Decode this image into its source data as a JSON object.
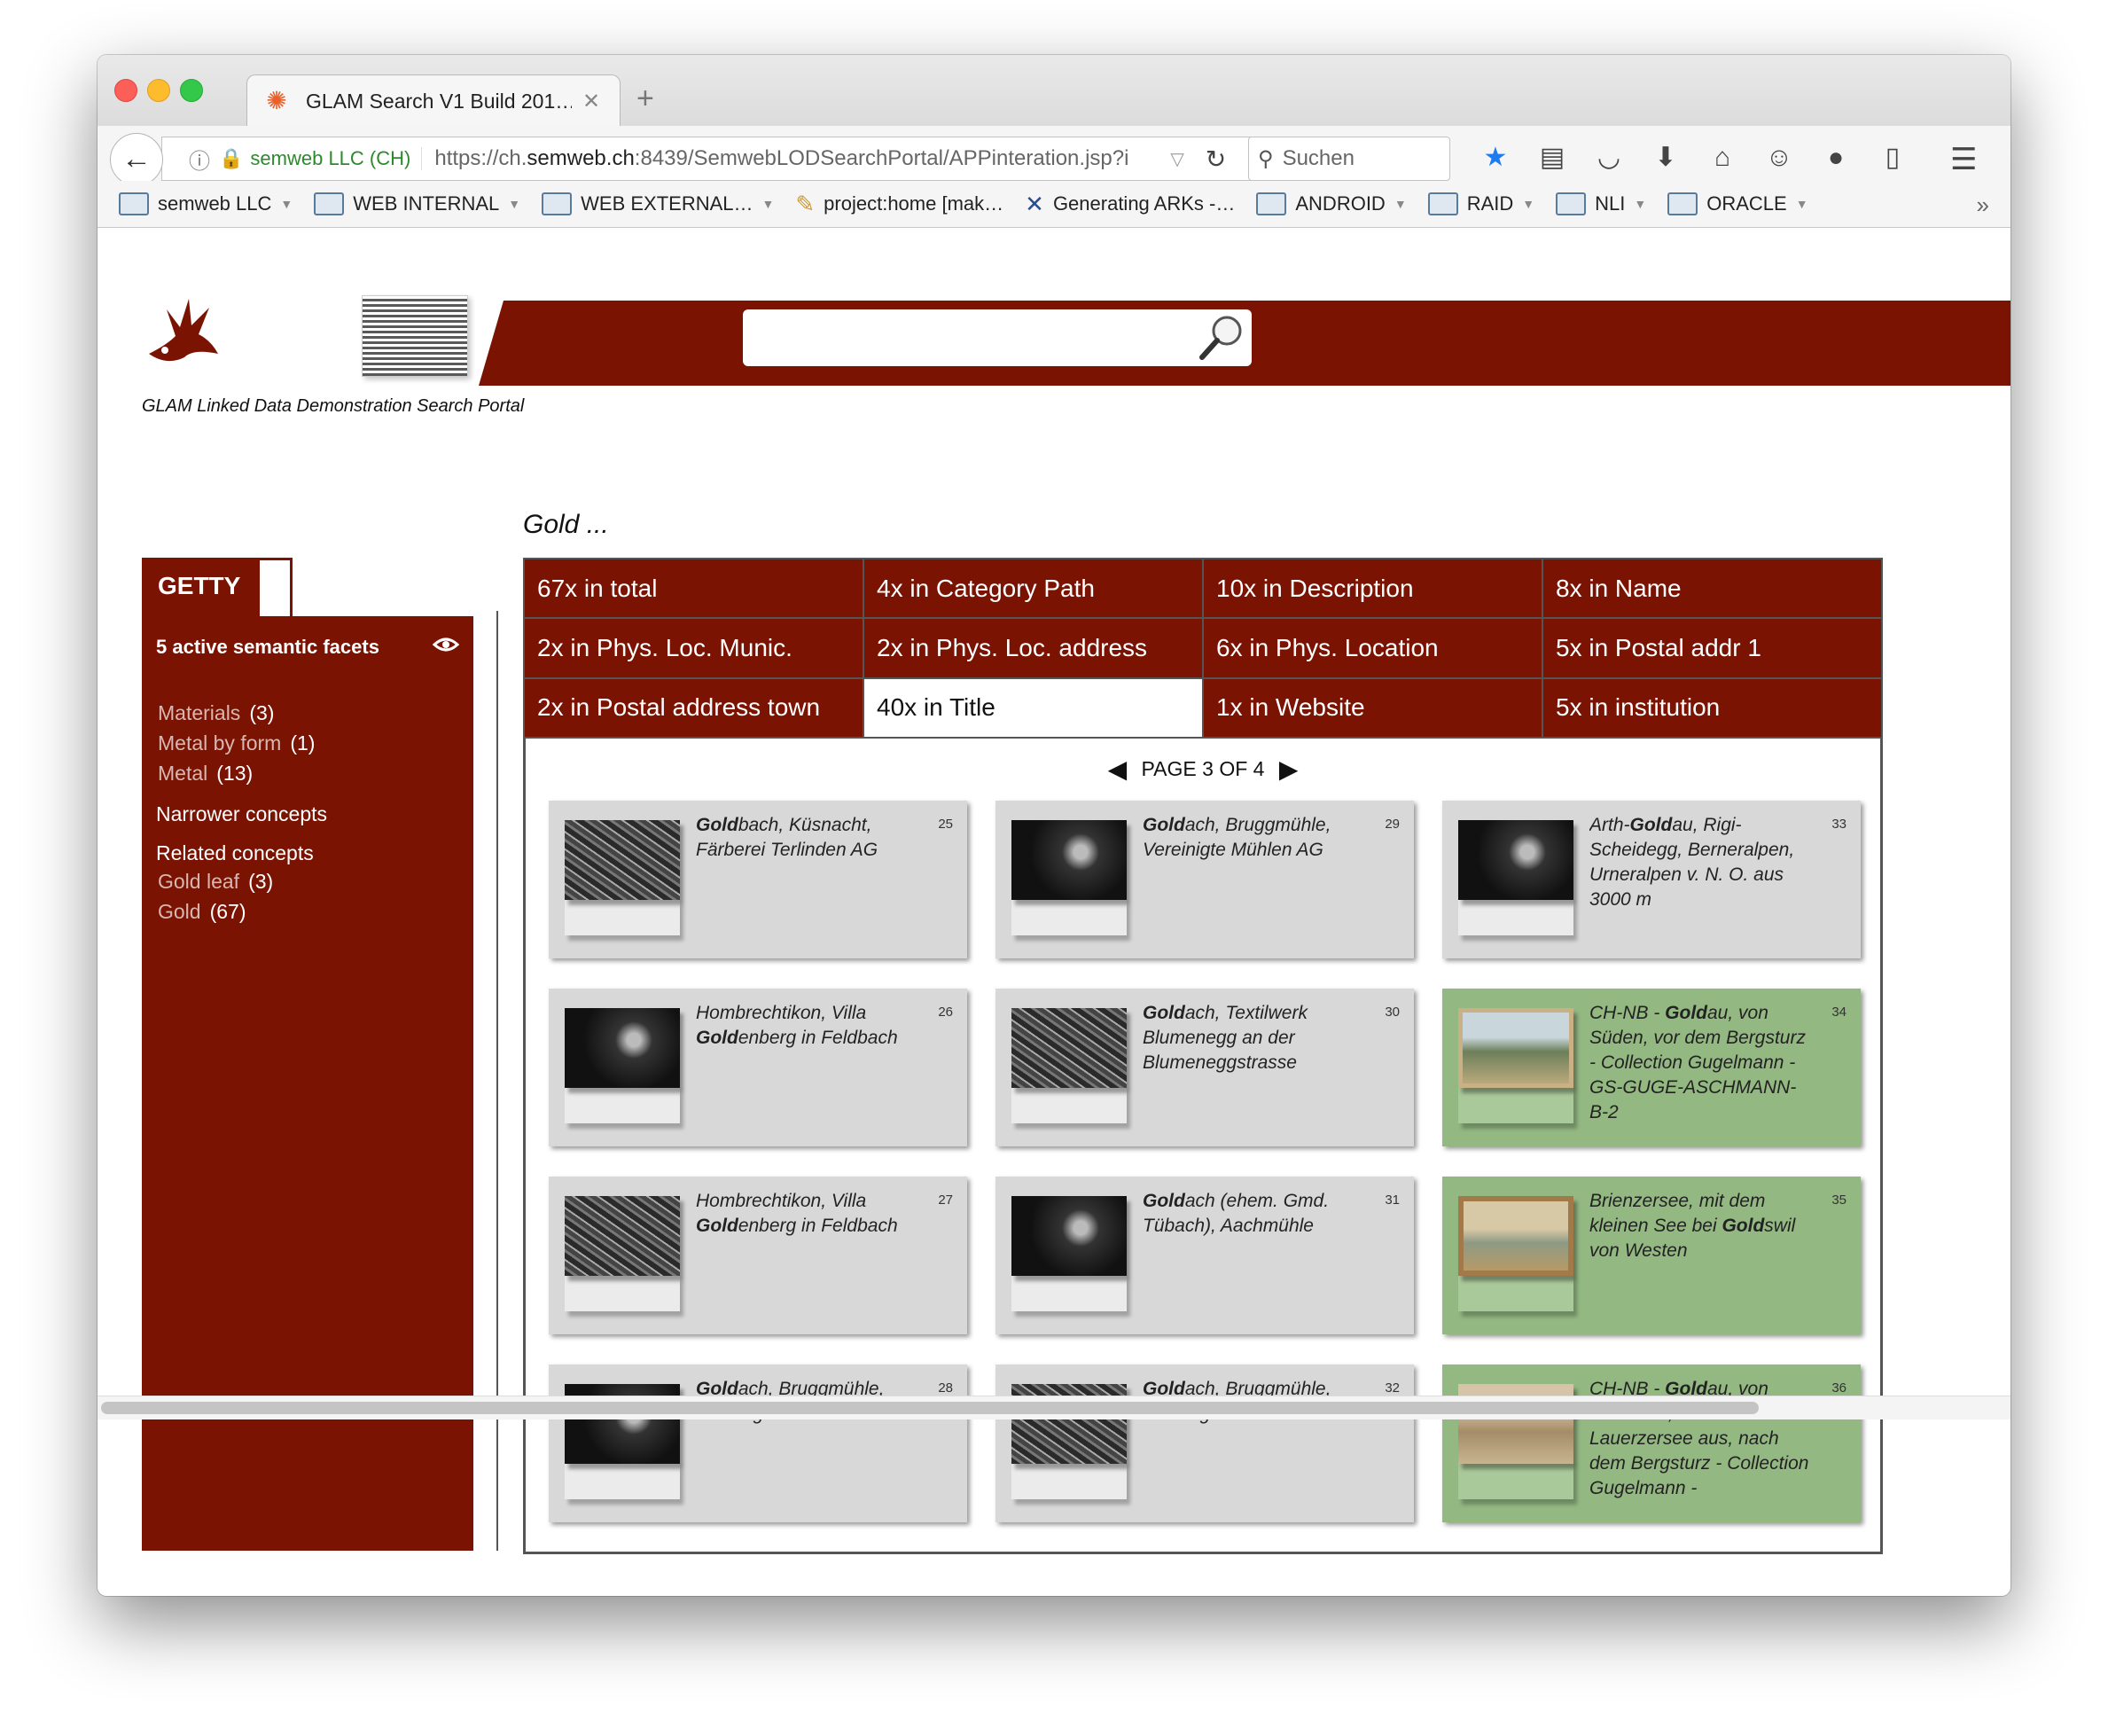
{
  "browser": {
    "tab_title": "GLAM Search V1 Build 201…",
    "site_identity": "semweb LLC (CH)",
    "url_prefix": "https://ch.",
    "url_host": "semweb.ch",
    "url_rest": ":8439/SemwebLODSearchPortal/APPinteration.jsp?i",
    "search_placeholder": "Suchen",
    "bookmarks": [
      {
        "label": "semweb LLC",
        "type": "folder"
      },
      {
        "label": "WEB INTERNAL",
        "type": "folder"
      },
      {
        "label": "WEB EXTERNAL…",
        "type": "folder"
      },
      {
        "label": "project:home [mak…",
        "type": "page"
      },
      {
        "label": "Generating ARKs -…",
        "type": "page"
      },
      {
        "label": "ANDROID",
        "type": "folder"
      },
      {
        "label": "RAID",
        "type": "folder"
      },
      {
        "label": "NLI",
        "type": "folder"
      },
      {
        "label": "ORACLE",
        "type": "folder"
      }
    ]
  },
  "portal": {
    "title": "GLAM Linked Data Demonstration Search Portal",
    "query_label": "Gold ...",
    "sidebar": {
      "tab_label": "GETTY",
      "facets_head": "5 active semantic facets",
      "facets": [
        {
          "label": "Materials",
          "count": "(3)"
        },
        {
          "label": "Metal by form",
          "count": "(1)"
        },
        {
          "label": "Metal",
          "count": "(13)"
        }
      ],
      "narrower_label": "Narrower concepts",
      "related_label": "Related concepts",
      "related": [
        {
          "label": "Gold leaf",
          "count": "(3)"
        },
        {
          "label": "Gold",
          "count": "(67)"
        }
      ]
    },
    "hits": [
      "67x in total",
      "4x in Category Path",
      "10x in Description",
      "8x in Name",
      "2x in Phys. Loc. Munic.",
      "2x in Phys. Loc. address",
      "6x in Phys. Location",
      "5x in Postal addr 1",
      "2x in Postal address town",
      "40x in Title",
      "1x in Website",
      "5x in institution"
    ],
    "pager": "PAGE 3 OF 4",
    "results": [
      {
        "num": "25",
        "pre": "",
        "bold": "Gold",
        "post": "bach, Küsnacht, Färberei Terlinden AG"
      },
      {
        "num": "26",
        "pre": "Hombrechtikon, Villa ",
        "bold": "Gold",
        "post": "enberg in Feldbach"
      },
      {
        "num": "27",
        "pre": "Hombrechtikon, Villa ",
        "bold": "Gold",
        "post": "enberg in Feldbach"
      },
      {
        "num": "28",
        "pre": "",
        "bold": "Gold",
        "post": "ach, Bruggmühle, Vereinigte Mühlen AG"
      },
      {
        "num": "29",
        "pre": "",
        "bold": "Gold",
        "post": "ach, Bruggmühle, Vereinigte Mühlen AG"
      },
      {
        "num": "30",
        "pre": "",
        "bold": "Gold",
        "post": "ach, Textilwerk Blumenegg an der Blumeneggstrasse"
      },
      {
        "num": "31",
        "pre": "",
        "bold": "Gold",
        "post": "ach (ehem. Gmd. Tübach), Aachmühle"
      },
      {
        "num": "32",
        "pre": "",
        "bold": "Gold",
        "post": "ach, Bruggmühle, Vereinigte Mühlen AG"
      },
      {
        "num": "33",
        "pre": "Arth-",
        "bold": "Gold",
        "post": "au, Rigi-Scheidegg, Berneralpen, Urneralpen v. N. O. aus 3000 m"
      },
      {
        "num": "34",
        "pre": "CH-NB - ",
        "bold": "Gold",
        "post": "au, von Süden, vor dem Bergsturz - Collection Gugelmann - GS-GUGE-ASCHMANN-B-2"
      },
      {
        "num": "35",
        "pre": "Brienzersee, mit dem kleinen See bei ",
        "bold": "Gold",
        "post": "swil von Westen"
      },
      {
        "num": "36",
        "pre": "CH-NB - ",
        "bold": "Gold",
        "post": "au, von Südosten, vom Lauerzersee aus, nach dem Bergsturz - Collection Gugelmann -"
      }
    ]
  }
}
